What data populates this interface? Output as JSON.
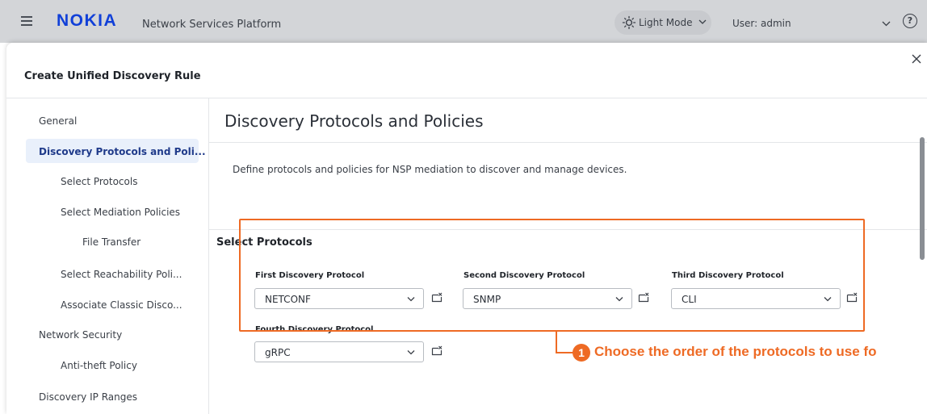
{
  "topbar": {
    "logo": "NOKIA",
    "app_title": "Network Services Platform",
    "theme_label": "Light Mode",
    "user_label": "User: admin",
    "help_label": "?"
  },
  "modal": {
    "title": "Create Unified Discovery Rule",
    "close_icon": "close-icon"
  },
  "nav": {
    "items": [
      {
        "label": "General"
      },
      {
        "label": "Discovery Protocols and Poli..."
      },
      {
        "label": "Select Protocols"
      },
      {
        "label": "Select Mediation Policies"
      },
      {
        "label": "File Transfer"
      },
      {
        "label": "Select Reachability Poli..."
      },
      {
        "label": "Associate Classic Disco..."
      },
      {
        "label": "Network Security"
      },
      {
        "label": "Anti-theft Policy"
      },
      {
        "label": "Discovery IP Ranges"
      }
    ],
    "active_index": 1
  },
  "content": {
    "section_title": "Discovery Protocols and Policies",
    "description": "Define protocols and policies for NSP mediation to discover and manage devices.",
    "subsection_title": "Select Protocols",
    "fields": [
      {
        "label": "First Discovery Protocol",
        "value": "NETCONF"
      },
      {
        "label": "Second Discovery Protocol",
        "value": "SNMP"
      },
      {
        "label": "Third Discovery Protocol",
        "value": "CLI"
      },
      {
        "label": "Fourth Discovery Protocol",
        "value": "gRPC"
      }
    ]
  },
  "annotation": {
    "number": "1",
    "text": "Choose the order of the protocols to use fo"
  },
  "colors": {
    "accent": "#ee6a24",
    "nav_active_bg": "#e9f0fb",
    "nav_active_text": "#1f3a8a",
    "topbar_bg": "#d3d5d8",
    "logo_blue": "#1140d8"
  }
}
